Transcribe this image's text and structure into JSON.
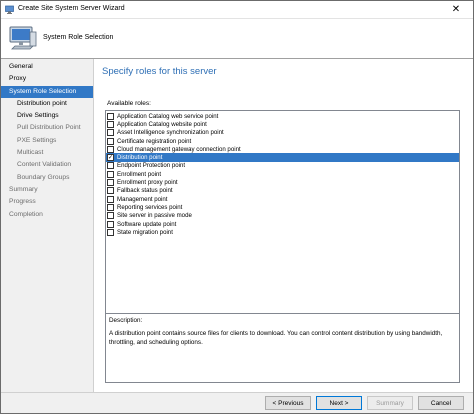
{
  "window": {
    "title": "Create Site System Server Wizard",
    "close_glyph": "✕"
  },
  "header": {
    "title": "System Role Selection",
    "icon": "computer-icon"
  },
  "nav": {
    "items": [
      {
        "label": "General",
        "level": 0,
        "state": "normal"
      },
      {
        "label": "Proxy",
        "level": 0,
        "state": "normal"
      },
      {
        "label": "System Role Selection",
        "level": 0,
        "state": "active"
      },
      {
        "label": "Distribution point",
        "level": 1,
        "state": "normal"
      },
      {
        "label": "Drive Settings",
        "level": 1,
        "state": "normal"
      },
      {
        "label": "Pull Distribution Point",
        "level": 1,
        "state": "dim"
      },
      {
        "label": "PXE Settings",
        "level": 1,
        "state": "dim"
      },
      {
        "label": "Multicast",
        "level": 1,
        "state": "dim"
      },
      {
        "label": "Content Validation",
        "level": 1,
        "state": "dim"
      },
      {
        "label": "Boundary Groups",
        "level": 1,
        "state": "dim"
      },
      {
        "label": "Summary",
        "level": 0,
        "state": "dim"
      },
      {
        "label": "Progress",
        "level": 0,
        "state": "dim"
      },
      {
        "label": "Completion",
        "level": 0,
        "state": "dim"
      }
    ]
  },
  "main": {
    "heading": "Specify roles for this server",
    "roles_label": "Available roles:",
    "roles": [
      {
        "label": "Application Catalog web service point",
        "checked": false,
        "selected": false
      },
      {
        "label": "Application Catalog website point",
        "checked": false,
        "selected": false
      },
      {
        "label": "Asset Intelligence synchronization point",
        "checked": false,
        "selected": false
      },
      {
        "label": "Certificate registration point",
        "checked": false,
        "selected": false
      },
      {
        "label": "Cloud management gateway connection point",
        "checked": false,
        "selected": false
      },
      {
        "label": "Distribution point",
        "checked": true,
        "selected": true
      },
      {
        "label": "Endpoint Protection point",
        "checked": false,
        "selected": false
      },
      {
        "label": "Enrollment point",
        "checked": false,
        "selected": false
      },
      {
        "label": "Enrollment proxy point",
        "checked": false,
        "selected": false
      },
      {
        "label": "Fallback status point",
        "checked": false,
        "selected": false
      },
      {
        "label": "Management point",
        "checked": false,
        "selected": false
      },
      {
        "label": "Reporting services point",
        "checked": false,
        "selected": false
      },
      {
        "label": "Site server in passive mode",
        "checked": false,
        "selected": false
      },
      {
        "label": "Software update point",
        "checked": false,
        "selected": false
      },
      {
        "label": "State migration point",
        "checked": false,
        "selected": false
      }
    ],
    "check_glyph": "✓",
    "description": {
      "label": "Description:",
      "text": "A distribution point contains source files for clients to download. You can control content distribution by using bandwidth, throttling, and scheduling options."
    }
  },
  "footer": {
    "previous": "< Previous",
    "next": "Next >",
    "summary": "Summary",
    "cancel": "Cancel"
  },
  "colors": {
    "accent": "#3178c6",
    "heading": "#2e6fb5"
  }
}
